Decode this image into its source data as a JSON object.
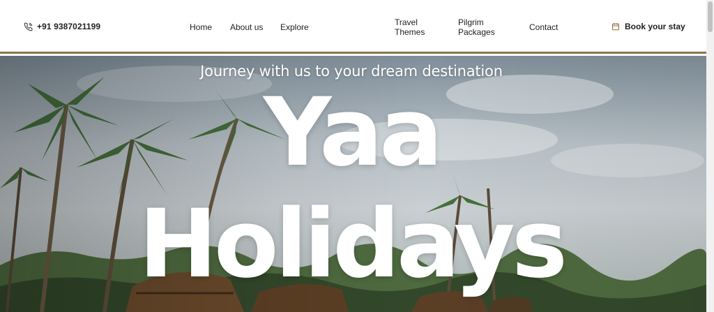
{
  "header": {
    "phone": "+91 9387021199",
    "nav": [
      {
        "label": "Home"
      },
      {
        "label": "About us"
      },
      {
        "label": "Explore"
      },
      {
        "label": "Travel Themes"
      },
      {
        "label": "Pilgrim Packages"
      },
      {
        "label": "Contact"
      }
    ],
    "book_label": "Book your stay",
    "icons": {
      "phone": "phone-icon",
      "calendar": "calendar-icon"
    },
    "border_color": "#8a7448"
  },
  "hero": {
    "tagline": "Journey with us to your dream destination",
    "title_line1": "Yaa",
    "title_line2": "Holidays"
  }
}
